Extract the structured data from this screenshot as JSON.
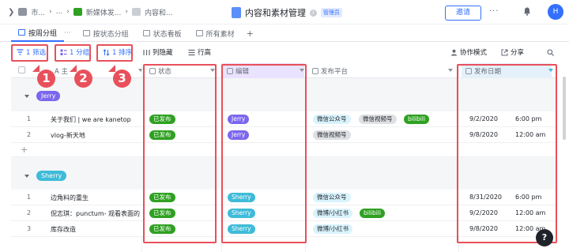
{
  "topbar": {
    "breadcrumbs": [
      "市...",
      "...",
      "新媒体发...",
      "内容和..."
    ],
    "title": "内容和素材管理",
    "info_icon": "info-icon",
    "admin_badge": "管理员",
    "invite_button": "邀请",
    "more": "···",
    "avatar_letter": "H"
  },
  "tabs": [
    {
      "label": "按周分组",
      "active": true
    },
    {
      "label": "按状态分组",
      "active": false
    },
    {
      "label": "状态看板",
      "active": false
    },
    {
      "label": "所有素材",
      "active": false
    }
  ],
  "tab_more": "···",
  "tab_add": "+",
  "toolbar": {
    "filter": "1 筛选",
    "group": "1 分组",
    "sort": "1 排序",
    "hide_fields": "列隐藏",
    "row_height": "行高",
    "collab": "协作模式",
    "share": "分享"
  },
  "annotations": [
    "1",
    "2",
    "3"
  ],
  "columns": {
    "title": "A  主",
    "status": "状态",
    "editor": "编辑",
    "platform": "发布平台",
    "date": "发布日期"
  },
  "groups": [
    {
      "name": "Jerry",
      "color": "#7b67ee",
      "rows": [
        {
          "num": "1",
          "title": "关于我们 | we are kanetop",
          "status": "已发布",
          "editor": "Jerry",
          "platforms": [
            "微信公众号",
            "微信视频号",
            "bilibili"
          ],
          "date": "9/2/2020",
          "time": "6:00 pm"
        },
        {
          "num": "2",
          "title": "vlog-新天地",
          "status": "已发布",
          "editor": "Jerry",
          "platforms": [
            "微信视频号"
          ],
          "date": "9/8/2020",
          "time": "12:00 am"
        }
      ],
      "add_label": "+"
    },
    {
      "name": "Sherry",
      "color": "#3ebbd9",
      "rows": [
        {
          "num": "1",
          "title": "边角料的重生",
          "status": "已发布",
          "editor": "Sherry",
          "platforms": [
            "微信公众号"
          ],
          "date": "8/31/2020",
          "time": "6:00 pm"
        },
        {
          "num": "2",
          "title": "倪志琪：punctum- 观看表面的",
          "status": "已发布",
          "editor": "Sherry",
          "platforms": [
            "微博/小红书",
            "bilibili"
          ],
          "date": "9/2/2020",
          "time": "12:00 am"
        },
        {
          "num": "3",
          "title": "库存改造",
          "status": "已发布",
          "editor": "Sherry",
          "platforms": [
            "微博/小红书"
          ],
          "date": "9/8/2020",
          "time": "12:00 am"
        }
      ]
    }
  ],
  "platform_colors": {
    "微信公众号": {
      "bg": "#d9f3fd",
      "fg": "#1f2329"
    },
    "微信视频号": {
      "bg": "#dee0e3",
      "fg": "#1f2329"
    },
    "bilibili": {
      "bg": "#2ea121",
      "fg": "#ffffff"
    },
    "微博/小红书": {
      "bg": "#d9f3fd",
      "fg": "#1f2329"
    }
  },
  "help": "?"
}
